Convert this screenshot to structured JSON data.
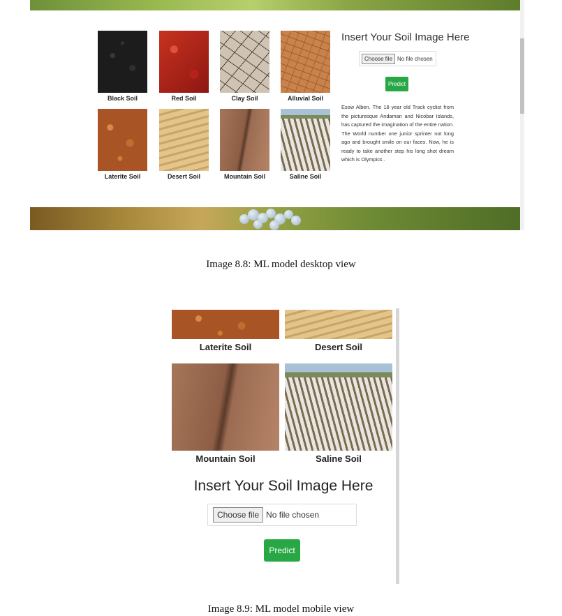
{
  "desktop": {
    "tiles": [
      {
        "label": "Black Soil"
      },
      {
        "label": "Red Soil"
      },
      {
        "label": "Clay Soil"
      },
      {
        "label": "Alluvial Soil"
      },
      {
        "label": "Laterite Soil"
      },
      {
        "label": "Desert Soil"
      },
      {
        "label": "Mountain Soil"
      },
      {
        "label": "Saline Soil"
      }
    ],
    "upload_title": "Insert Your Soil Image Here",
    "choose_file_label": "Choose file",
    "no_file_text": "No file chosen",
    "predict_label": "Predict",
    "paragraph": "Esow Alben. The 18 year old Track cyclist from the picturesque Andaman and Nicobar Islands, has captured the imagination of the entire nation. The World number one junior sprinter not long ago and brought smile on our faces. Now, he is ready to take another step his long shot dream which is Olympics ."
  },
  "mobile": {
    "tiles": [
      {
        "label": "Laterite Soil"
      },
      {
        "label": "Desert Soil"
      },
      {
        "label": "Mountain Soil"
      },
      {
        "label": "Saline Soil"
      }
    ],
    "upload_title": "Insert Your Soil Image Here",
    "choose_file_label": "Choose file",
    "no_file_text": "No file chosen",
    "predict_label": "Predict"
  },
  "captions": {
    "desktop": "Image 8.8: ML model desktop view",
    "mobile": "Image 8.9: ML model mobile view"
  },
  "colors": {
    "predict_button": "#28a745"
  }
}
